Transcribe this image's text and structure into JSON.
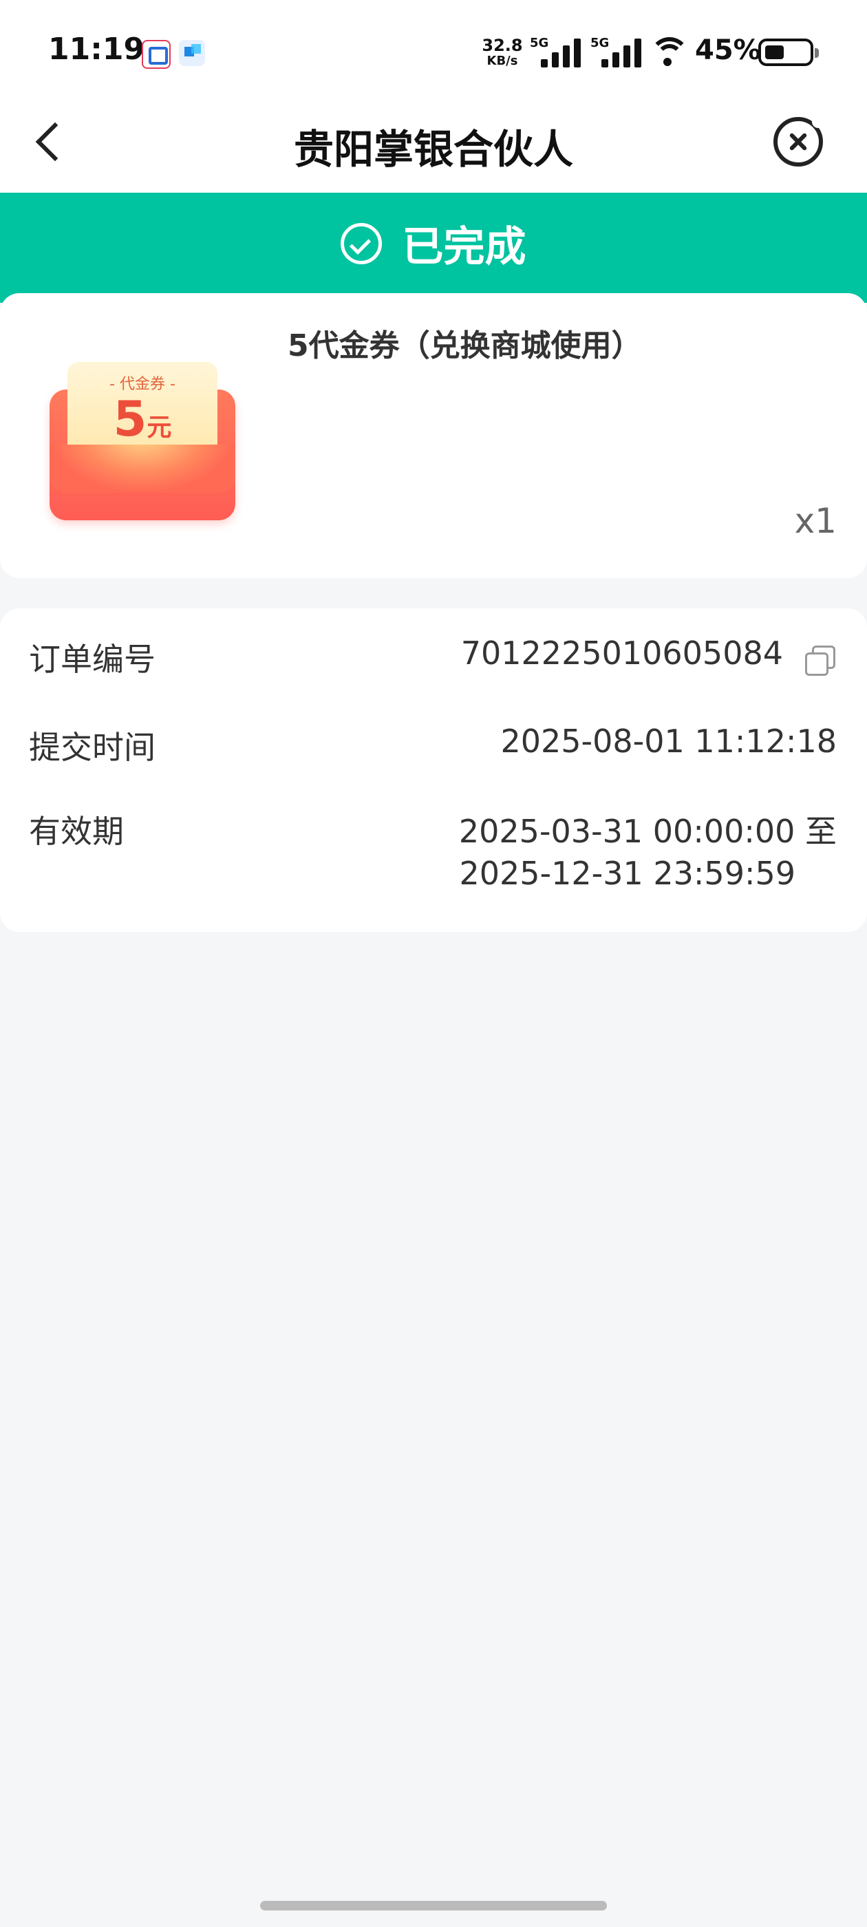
{
  "status_bar": {
    "time": "11:19",
    "net_speed_value": "32.8",
    "net_speed_unit": "KB/s",
    "sim1_label": "5G",
    "sim2_label": "5G",
    "battery": "45%",
    "battery_level": 0.45
  },
  "nav": {
    "title": "贵阳掌银合伙人"
  },
  "status_banner": {
    "text": "已完成"
  },
  "product": {
    "title": "5代金券（兑换商城使用）",
    "coupon_label": "- 代金券 -",
    "coupon_value": "5",
    "coupon_unit": "元",
    "quantity": "x1"
  },
  "order_info": {
    "order_no_label": "订单编号",
    "order_no_value": "7012225010605084",
    "submit_time_label": "提交时间",
    "submit_time_value": "2025-08-01 11:12:18",
    "validity_label": "有效期",
    "validity_value_line1": "2025-03-31 00:00:00 至",
    "validity_value_line2": "2025-12-31 23:59:59"
  },
  "colors": {
    "accent": "#00c3a0",
    "page_bg": "#f5f6f8",
    "card_bg": "#ffffff"
  }
}
